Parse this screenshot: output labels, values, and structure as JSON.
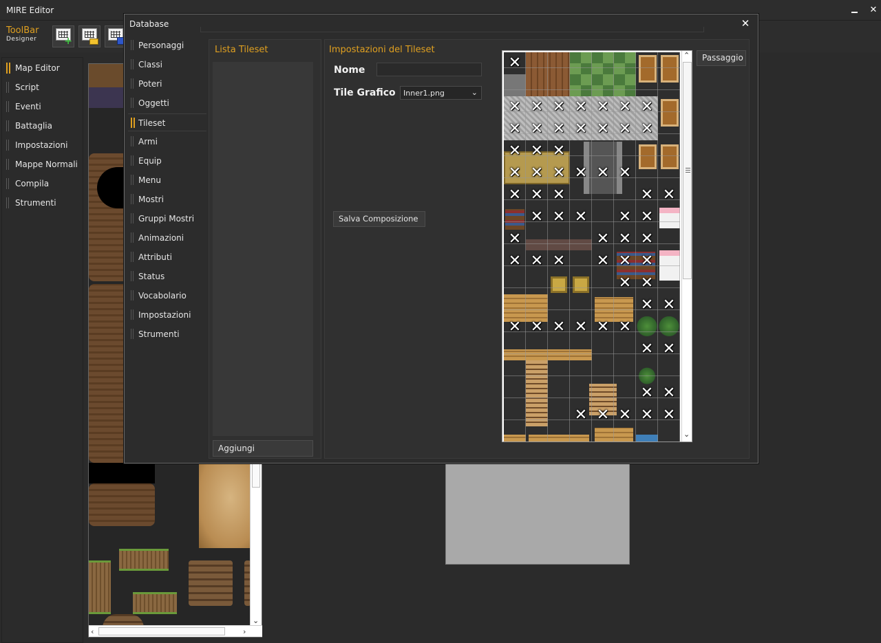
{
  "app": {
    "title": "MIRE Editor",
    "close_glyph": "✕"
  },
  "toolbar": {
    "brand": "ToolBar",
    "sub": "Designer",
    "buttons": [
      {
        "icon": "new-map-icon"
      },
      {
        "icon": "open-map-icon"
      },
      {
        "icon": "save-map-icon"
      }
    ]
  },
  "main_nav": {
    "items": [
      {
        "label": "Map Editor",
        "active": true
      },
      {
        "label": "Script"
      },
      {
        "label": "Eventi"
      },
      {
        "label": "Battaglia"
      },
      {
        "label": "Impostazioni"
      },
      {
        "label": "Mappe Normali"
      },
      {
        "label": "Compila"
      },
      {
        "label": "Strumenti"
      }
    ]
  },
  "database": {
    "title": "Database",
    "close_glyph": "✕",
    "nav": [
      {
        "label": "Personaggi"
      },
      {
        "label": "Classi"
      },
      {
        "label": "Poteri"
      },
      {
        "label": "Oggetti"
      },
      {
        "label": "Tileset",
        "active": true
      },
      {
        "label": "Armi"
      },
      {
        "label": "Equip"
      },
      {
        "label": "Menu"
      },
      {
        "label": "Mostri"
      },
      {
        "label": "Gruppi Mostri"
      },
      {
        "label": "Animazioni"
      },
      {
        "label": "Attributi"
      },
      {
        "label": "Status"
      },
      {
        "label": "Vocabolario"
      },
      {
        "label": "Impostazioni"
      },
      {
        "label": "Strumenti"
      }
    ],
    "tileset_list": {
      "title": "Lista Tileset",
      "add_button": "Aggiungi"
    },
    "tileset_settings": {
      "title": "Impostazioni del Tileset",
      "name_label": "Nome",
      "name_value": "",
      "graphic_label": "Tile Grafico",
      "graphic_value": "Inner1.png",
      "save_button": "Salva Composizione",
      "passability_button": "Passaggio",
      "blocked_glyph": "✕"
    }
  },
  "colors": {
    "accent": "#e0a020",
    "window_bg": "#2b2b2b",
    "panel_bg": "#303030",
    "text": "#e6e6e6"
  }
}
